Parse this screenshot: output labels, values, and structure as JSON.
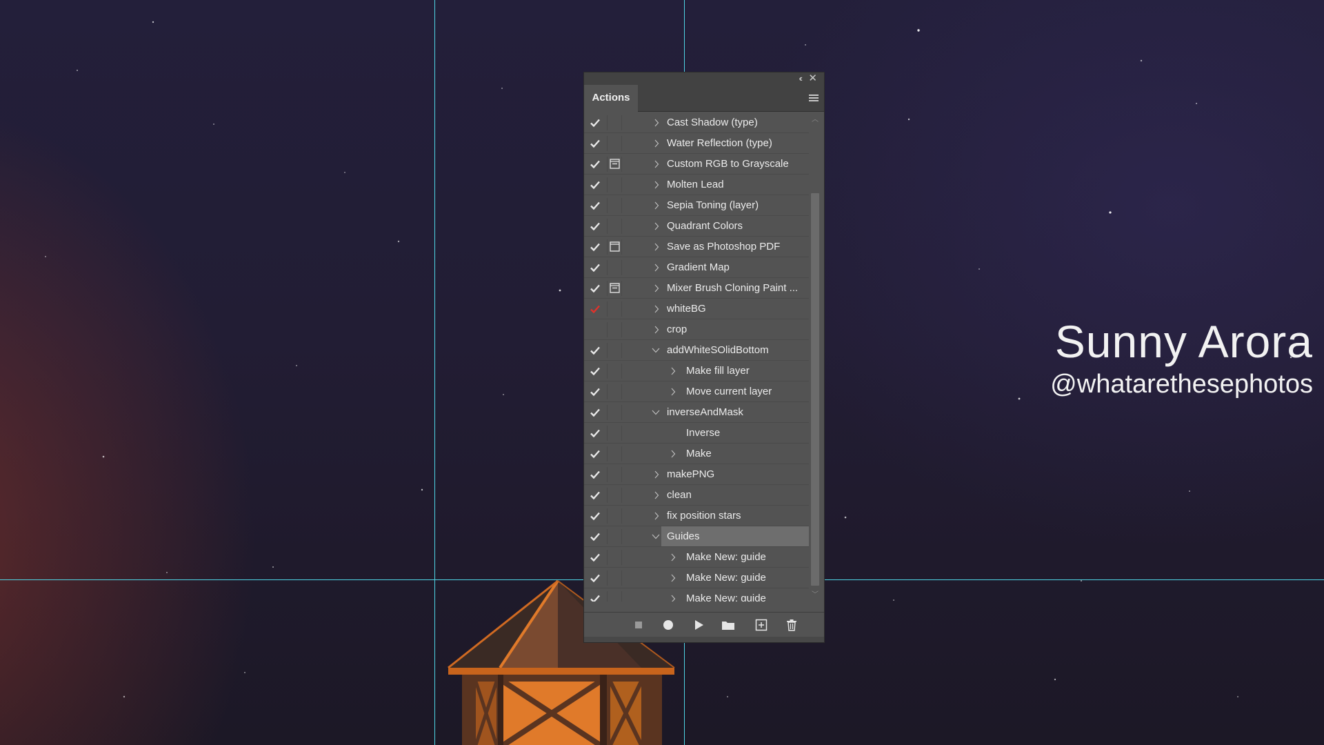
{
  "panel": {
    "tab_label": "Actions",
    "collapse_glyph": "‹‹",
    "close_glyph": "✕"
  },
  "actions": [
    {
      "label": "Cast Shadow (type)",
      "level": 0,
      "expand": "collapsed",
      "check": "white",
      "dialog": false
    },
    {
      "label": "Water Reflection (type)",
      "level": 0,
      "expand": "collapsed",
      "check": "white",
      "dialog": false
    },
    {
      "label": "Custom RGB to Grayscale",
      "level": 0,
      "expand": "collapsed",
      "check": "white",
      "dialog": "partial"
    },
    {
      "label": "Molten Lead",
      "level": 0,
      "expand": "collapsed",
      "check": "white",
      "dialog": false
    },
    {
      "label": "Sepia Toning (layer)",
      "level": 0,
      "expand": "collapsed",
      "check": "white",
      "dialog": false
    },
    {
      "label": "Quadrant Colors",
      "level": 0,
      "expand": "collapsed",
      "check": "white",
      "dialog": false
    },
    {
      "label": "Save as Photoshop PDF",
      "level": 0,
      "expand": "collapsed",
      "check": "white",
      "dialog": "full"
    },
    {
      "label": "Gradient Map",
      "level": 0,
      "expand": "collapsed",
      "check": "white",
      "dialog": false
    },
    {
      "label": "Mixer Brush Cloning Paint ...",
      "level": 0,
      "expand": "collapsed",
      "check": "white",
      "dialog": "partial"
    },
    {
      "label": "whiteBG",
      "level": 0,
      "expand": "collapsed",
      "check": "red",
      "dialog": false
    },
    {
      "label": "crop",
      "level": 0,
      "expand": "collapsed",
      "check": "none",
      "dialog": false
    },
    {
      "label": "addWhiteSOlidBottom",
      "level": 0,
      "expand": "expanded",
      "check": "white",
      "dialog": false
    },
    {
      "label": "Make fill layer",
      "level": 1,
      "expand": "collapsed",
      "check": "white",
      "dialog": false
    },
    {
      "label": "Move current layer",
      "level": 1,
      "expand": "collapsed",
      "check": "white",
      "dialog": false
    },
    {
      "label": "inverseAndMask",
      "level": 0,
      "expand": "expanded",
      "check": "white",
      "dialog": false
    },
    {
      "label": "Inverse",
      "level": 1,
      "expand": "none",
      "check": "white",
      "dialog": false
    },
    {
      "label": "Make",
      "level": 1,
      "expand": "collapsed",
      "check": "white",
      "dialog": false
    },
    {
      "label": "makePNG",
      "level": 0,
      "expand": "collapsed",
      "check": "white",
      "dialog": false
    },
    {
      "label": "clean",
      "level": 0,
      "expand": "collapsed",
      "check": "white",
      "dialog": false
    },
    {
      "label": "fix position stars",
      "level": 0,
      "expand": "collapsed",
      "check": "white",
      "dialog": false
    },
    {
      "label": "Guides",
      "level": 0,
      "expand": "expanded",
      "check": "white",
      "dialog": false,
      "selected": true
    },
    {
      "label": "Make New: guide",
      "level": 1,
      "expand": "collapsed",
      "check": "white",
      "dialog": false
    },
    {
      "label": "Make New: guide",
      "level": 1,
      "expand": "collapsed",
      "check": "white",
      "dialog": false
    },
    {
      "label": "Make New: guide",
      "level": 1,
      "expand": "collapsed",
      "check": "white",
      "dialog": false
    }
  ],
  "footer_buttons": [
    {
      "name": "stop-button",
      "icon": "stop-icon"
    },
    {
      "name": "record-button",
      "icon": "record-icon"
    },
    {
      "name": "play-button",
      "icon": "play-icon"
    },
    {
      "name": "new-set-button",
      "icon": "folder-icon"
    },
    {
      "name": "new-action-button",
      "icon": "new-item-icon"
    },
    {
      "name": "delete-button",
      "icon": "trash-icon"
    }
  ],
  "credit": {
    "name": "Sunny Arora",
    "handle": "@whatarethesephotos"
  },
  "colors": {
    "guide": "#4fd6e6",
    "panel_bg": "#535353",
    "check_red": "#e0322b",
    "lantern": "#e07a2a"
  }
}
